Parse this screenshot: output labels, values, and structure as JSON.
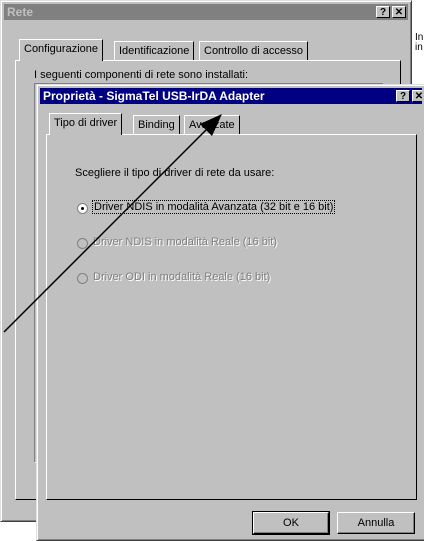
{
  "rete": {
    "title": "Rete",
    "help_btn": "?",
    "close_btn": "✕",
    "tabs": [
      "Configurazione",
      "Identificazione",
      "Controllo di accesso"
    ],
    "installed_text": "I seguenti componenti di rete sono installati:",
    "side_text_1": "In",
    "side_text_2": "in"
  },
  "props": {
    "title": "Proprietà - SigmaTel USB-IrDA Adapter",
    "help_btn": "?",
    "close_btn": "✕",
    "tabs": [
      "Tipo di driver",
      "Binding",
      "Avanzate"
    ],
    "prompt": "Scegliere il tipo di driver di rete da usare:",
    "options": [
      "Driver NDIS in modalità Avanzata (32 bit e 16 bit)",
      "Driver NDIS in modalità Reale (16 bit)",
      "Driver ODI in modalità Reale (16 bit)"
    ],
    "selected_option": 0,
    "ok_label": "OK",
    "cancel_label": "Annulla"
  },
  "annotation": {
    "arrow_color": "#000000",
    "target": "Avanzate"
  }
}
